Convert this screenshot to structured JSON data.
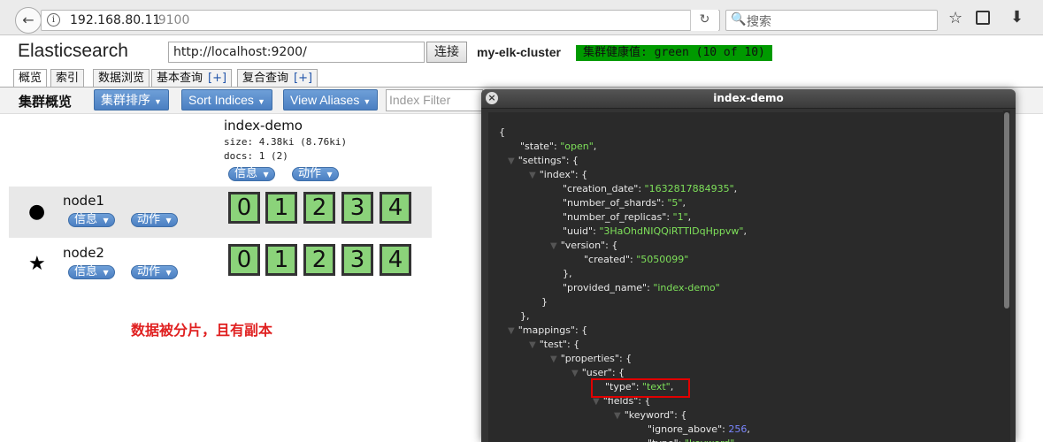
{
  "browser": {
    "url_host": "192.168.80.11",
    "url_port": ":9100",
    "search_placeholder": "搜索",
    "back_glyph": "←",
    "info_glyph": "i",
    "reload_glyph": "↻",
    "search_glyph": "🔍",
    "star_glyph": "☆",
    "download_glyph": "⬇"
  },
  "header": {
    "title": "Elasticsearch",
    "connection_url": "http://localhost:9200/",
    "connect_label": "连接",
    "cluster_name": "my-elk-cluster",
    "health": "集群健康值: green (10 of 10)"
  },
  "tabs": [
    {
      "label": "概览",
      "plus": ""
    },
    {
      "label": "索引",
      "plus": ""
    },
    {
      "label": "数据浏览",
      "plus": ""
    },
    {
      "label": "基本查询",
      "plus": "[+]"
    },
    {
      "label": "复合查询",
      "plus": "[+]"
    }
  ],
  "toolbar": {
    "overview_label": "集群概览",
    "sort_cluster": "集群排序",
    "sort_indices": "Sort Indices",
    "view_aliases": "View Aliases",
    "index_filter_placeholder": "Index Filter"
  },
  "index": {
    "name": "index-demo",
    "size": "size: 4.38ki (8.76ki)",
    "docs": "docs: 1 (2)",
    "info_label": "信息",
    "action_label": "动作"
  },
  "nodes": [
    {
      "name": "node1",
      "marker": "●",
      "info_label": "信息",
      "action_label": "动作",
      "shards": [
        "0",
        "1",
        "2",
        "3",
        "4"
      ]
    },
    {
      "name": "node2",
      "marker": "★",
      "info_label": "信息",
      "action_label": "动作",
      "shards": [
        "0",
        "1",
        "2",
        "3",
        "4"
      ]
    }
  ],
  "annotation": "数据被分片，且有副本",
  "modal": {
    "title": "index-demo",
    "close_glyph": "×",
    "json_lines": [
      {
        "indent": 0,
        "tri": false,
        "parts": [
          {
            "t": "{",
            "c": "key"
          }
        ]
      },
      {
        "indent": 1,
        "tri": false,
        "parts": [
          {
            "t": "\"state\": ",
            "c": "key"
          },
          {
            "t": "\"open\"",
            "c": "str"
          },
          {
            "t": ",",
            "c": "key"
          }
        ]
      },
      {
        "indent": 1,
        "tri": true,
        "parts": [
          {
            "t": "\"settings\": {",
            "c": "key"
          }
        ]
      },
      {
        "indent": 2,
        "tri": true,
        "parts": [
          {
            "t": "\"index\": {",
            "c": "key"
          }
        ]
      },
      {
        "indent": 3,
        "tri": false,
        "parts": [
          {
            "t": "\"creation_date\": ",
            "c": "key"
          },
          {
            "t": "\"1632817884935\"",
            "c": "str"
          },
          {
            "t": ",",
            "c": "key"
          }
        ]
      },
      {
        "indent": 3,
        "tri": false,
        "parts": [
          {
            "t": "\"number_of_shards\": ",
            "c": "key"
          },
          {
            "t": "\"5\"",
            "c": "str"
          },
          {
            "t": ",",
            "c": "key"
          }
        ]
      },
      {
        "indent": 3,
        "tri": false,
        "parts": [
          {
            "t": "\"number_of_replicas\": ",
            "c": "key"
          },
          {
            "t": "\"1\"",
            "c": "str"
          },
          {
            "t": ",",
            "c": "key"
          }
        ]
      },
      {
        "indent": 3,
        "tri": false,
        "parts": [
          {
            "t": "\"uuid\": ",
            "c": "key"
          },
          {
            "t": "\"3HaOhdNIQQiRTTIDqHppvw\"",
            "c": "str"
          },
          {
            "t": ",",
            "c": "key"
          }
        ]
      },
      {
        "indent": 3,
        "tri": true,
        "parts": [
          {
            "t": "\"version\": {",
            "c": "key"
          }
        ]
      },
      {
        "indent": 4,
        "tri": false,
        "parts": [
          {
            "t": "\"created\": ",
            "c": "key"
          },
          {
            "t": "\"5050099\"",
            "c": "str"
          }
        ]
      },
      {
        "indent": 3,
        "tri": false,
        "parts": [
          {
            "t": "},",
            "c": "key"
          }
        ]
      },
      {
        "indent": 3,
        "tri": false,
        "parts": [
          {
            "t": "\"provided_name\": ",
            "c": "key"
          },
          {
            "t": "\"index-demo\"",
            "c": "str"
          }
        ]
      },
      {
        "indent": 2,
        "tri": false,
        "parts": [
          {
            "t": "}",
            "c": "key"
          }
        ]
      },
      {
        "indent": 1,
        "tri": false,
        "parts": [
          {
            "t": "},",
            "c": "key"
          }
        ]
      },
      {
        "indent": 1,
        "tri": true,
        "parts": [
          {
            "t": "\"mappings\": {",
            "c": "key"
          }
        ]
      },
      {
        "indent": 2,
        "tri": true,
        "parts": [
          {
            "t": "\"test\": {",
            "c": "key"
          }
        ]
      },
      {
        "indent": 3,
        "tri": true,
        "parts": [
          {
            "t": "\"properties\": {",
            "c": "key"
          }
        ]
      },
      {
        "indent": 4,
        "tri": true,
        "parts": [
          {
            "t": "\"user\": {",
            "c": "key"
          }
        ]
      },
      {
        "indent": 5,
        "tri": false,
        "parts": [
          {
            "t": "\"type\": ",
            "c": "key"
          },
          {
            "t": "\"text\"",
            "c": "str"
          },
          {
            "t": ",",
            "c": "key"
          }
        ]
      },
      {
        "indent": 5,
        "tri": true,
        "parts": [
          {
            "t": "\"fields\": {",
            "c": "key"
          }
        ]
      },
      {
        "indent": 6,
        "tri": true,
        "parts": [
          {
            "t": "\"keyword\": {",
            "c": "key"
          }
        ]
      },
      {
        "indent": 7,
        "tri": false,
        "parts": [
          {
            "t": "\"ignore_above\": ",
            "c": "key"
          },
          {
            "t": "256",
            "c": "num"
          },
          {
            "t": ",",
            "c": "key"
          }
        ]
      },
      {
        "indent": 7,
        "tri": false,
        "parts": [
          {
            "t": "\"type\": ",
            "c": "key"
          },
          {
            "t": "\"keyword\"",
            "c": "str"
          }
        ]
      }
    ]
  },
  "colors": {
    "health_green": "#009a00",
    "shard_green": "#8bd37a",
    "button_blue": "#5a8ccc",
    "json_string": "#7ee05a",
    "json_number": "#7a86ff",
    "highlight_red": "#e00000"
  }
}
